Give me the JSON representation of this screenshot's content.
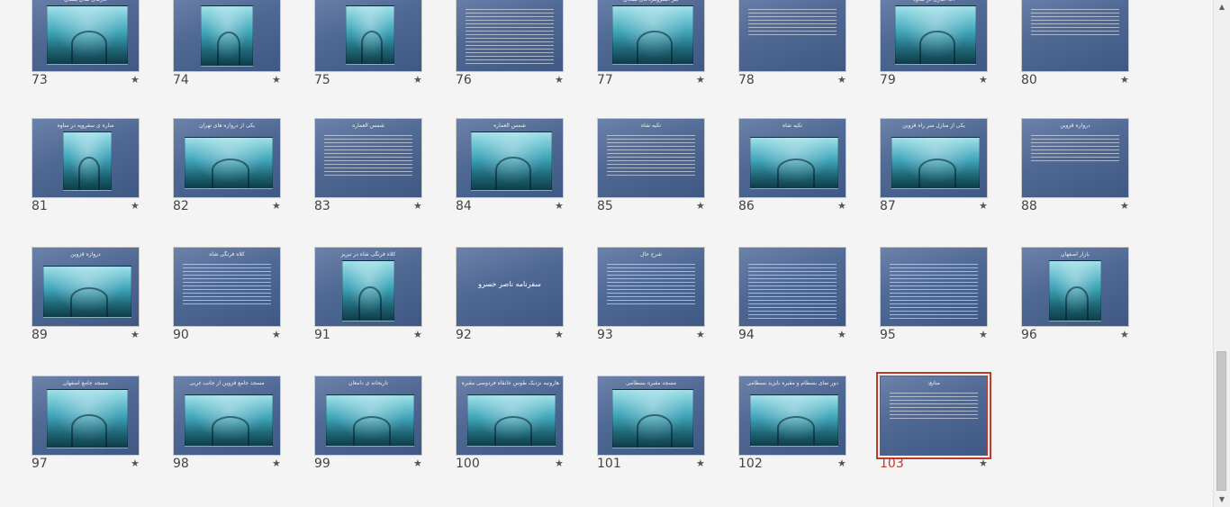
{
  "slides": [
    {
      "num": "73",
      "title": "غارهای طاق بستان",
      "kind": "image"
    },
    {
      "num": "74",
      "title": "",
      "kind": "portrait"
    },
    {
      "num": "75",
      "title": "",
      "kind": "narrow"
    },
    {
      "num": "76",
      "title": "",
      "kind": "text"
    },
    {
      "num": "77",
      "title": "قبر استرومردخای همدان",
      "kind": "image"
    },
    {
      "num": "78",
      "title": "",
      "kind": "text-short"
    },
    {
      "num": "79",
      "title": "آب انباری در ساوه",
      "kind": "image"
    },
    {
      "num": "80",
      "title": "",
      "kind": "text-short"
    },
    {
      "num": "81",
      "title": "مناره ی سفروپه در ساوه",
      "kind": "narrow"
    },
    {
      "num": "82",
      "title": "یکی از دروازه های تهران",
      "kind": "wide"
    },
    {
      "num": "83",
      "title": "شمس العماره",
      "kind": "text-med"
    },
    {
      "num": "84",
      "title": "شمس العماره",
      "kind": "image"
    },
    {
      "num": "85",
      "title": "تکیه شاه",
      "kind": "text-med"
    },
    {
      "num": "86",
      "title": "تکیه شاه",
      "kind": "wide"
    },
    {
      "num": "87",
      "title": "یکی از منازل سر راه قزوین",
      "kind": "wide"
    },
    {
      "num": "88",
      "title": "دروازه قزوین",
      "kind": "text-short"
    },
    {
      "num": "89",
      "title": "دروازه قزوین",
      "kind": "wide"
    },
    {
      "num": "90",
      "title": "کلاه فرنگی شاه",
      "kind": "text-med"
    },
    {
      "num": "91",
      "title": "کلاه فرنگی شاه در تبریز",
      "kind": "portrait"
    },
    {
      "num": "92",
      "title": "",
      "kind": "title",
      "center": "سفرنامه ناصر خسرو"
    },
    {
      "num": "93",
      "title": "شرح حال",
      "kind": "text-med"
    },
    {
      "num": "94",
      "title": "",
      "kind": "text"
    },
    {
      "num": "95",
      "title": "",
      "kind": "text"
    },
    {
      "num": "96",
      "title": "بازار اصفهان",
      "kind": "portrait"
    },
    {
      "num": "97",
      "title": "مسجد جامع اصفهان",
      "kind": "image"
    },
    {
      "num": "98",
      "title": "مسجد جامع قزوین از جانب غربی",
      "kind": "wide"
    },
    {
      "num": "99",
      "title": "تاریخانه ی دامغان",
      "kind": "wide"
    },
    {
      "num": "100",
      "title": "هارونیه نزدیک طوس خانقاه فردوسی مقبره غزالی",
      "kind": "wide"
    },
    {
      "num": "101",
      "title": "مسجد مقبره بسطامی",
      "kind": "image"
    },
    {
      "num": "102",
      "title": "دور نمای بسطام و مقبره بایزید بسطامی",
      "kind": "wide"
    },
    {
      "num": "103",
      "title": "منابع:",
      "kind": "text-short",
      "selected": true
    }
  ],
  "star_glyph": "★",
  "scrollbar": {
    "up_arrow": "▲",
    "down_arrow": "▼",
    "position_fraction": 0.82
  },
  "colors": {
    "selection": "#c0392b",
    "slide_bg": "#4f6894",
    "photo_tint": "#3fa4b8"
  }
}
